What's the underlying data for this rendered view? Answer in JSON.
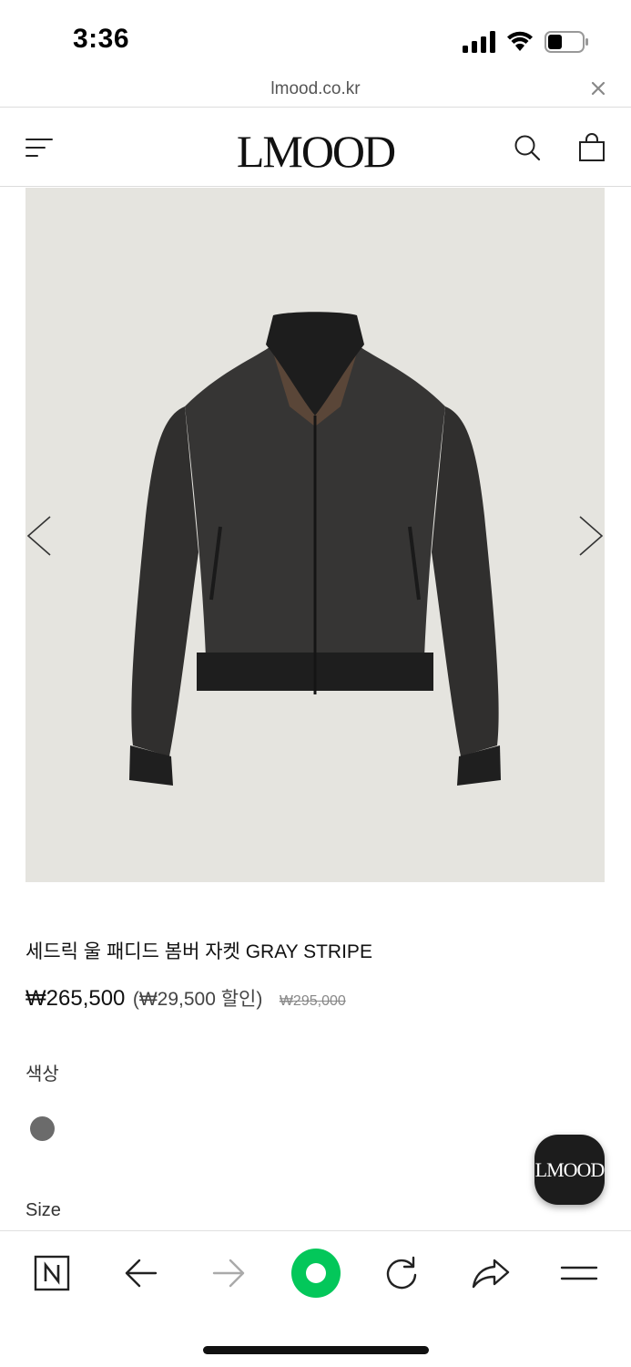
{
  "status_bar": {
    "time": "3:36",
    "icons": [
      "signal-icon",
      "wifi-icon",
      "battery-icon"
    ]
  },
  "address_bar": {
    "url": "lmood.co.kr",
    "close_icon": "close-icon"
  },
  "header": {
    "logo": "LMOOD",
    "menu_icon": "menu-icon",
    "search_icon": "search-icon",
    "cart_icon": "cart-icon"
  },
  "gallery": {
    "image": "dark gray wool bomber jacket",
    "prev_icon": "chevron-left-icon",
    "next_icon": "chevron-right-icon",
    "background": "#e5e4df"
  },
  "product": {
    "name": "세드릭 울 패디드 봄버 자켓 GRAY STRIPE",
    "price": "₩265,500",
    "discount": "(₩29,500 할인)",
    "original_price": "₩295,000",
    "color_label": "색상",
    "color_swatch": "#6b6b6b",
    "size_label": "Size"
  },
  "floating_button": {
    "label": "LMOOD"
  },
  "toolbar": {
    "items": [
      "naver-home-icon",
      "back-arrow-icon",
      "forward-arrow-icon",
      "green-dot-button",
      "refresh-icon",
      "share-icon",
      "more-menu-icon"
    ],
    "accent": "#03c75a"
  }
}
